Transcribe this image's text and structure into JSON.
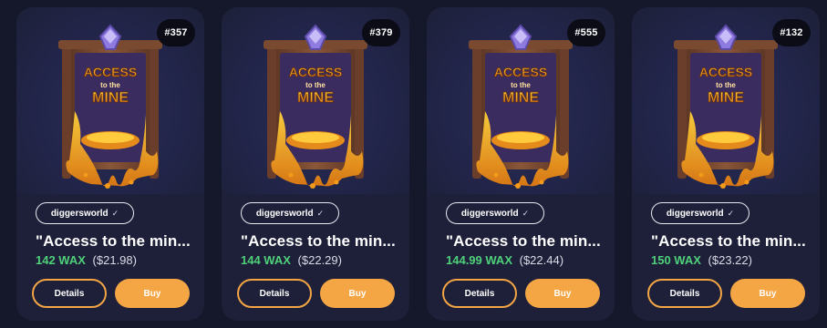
{
  "colors": {
    "background": "#15172a",
    "card": "#1d2038",
    "accent": "#f4a544",
    "price_green": "#4fd07a"
  },
  "cards": [
    {
      "mint": "#357",
      "collection": "diggersworld",
      "title": "\"Access to the min...",
      "price_wax": "142 WAX",
      "price_usd": "($21.98)",
      "details_label": "Details",
      "buy_label": "Buy"
    },
    {
      "mint": "#379",
      "collection": "diggersworld",
      "title": "\"Access to the min...",
      "price_wax": "144 WAX",
      "price_usd": "($22.29)",
      "details_label": "Details",
      "buy_label": "Buy"
    },
    {
      "mint": "#555",
      "collection": "diggersworld",
      "title": "\"Access to the min...",
      "price_wax": "144.99 WAX",
      "price_usd": "($22.44)",
      "details_label": "Details",
      "buy_label": "Buy"
    },
    {
      "mint": "#132",
      "collection": "diggersworld",
      "title": "\"Access to the min...",
      "price_wax": "150 WAX",
      "price_usd": "($23.22)",
      "details_label": "Details",
      "buy_label": "Buy"
    }
  ],
  "verified_icon": "checkmark-icon",
  "art_text": {
    "line1": "ACCESS",
    "line2": "to the",
    "line3": "MINE"
  }
}
